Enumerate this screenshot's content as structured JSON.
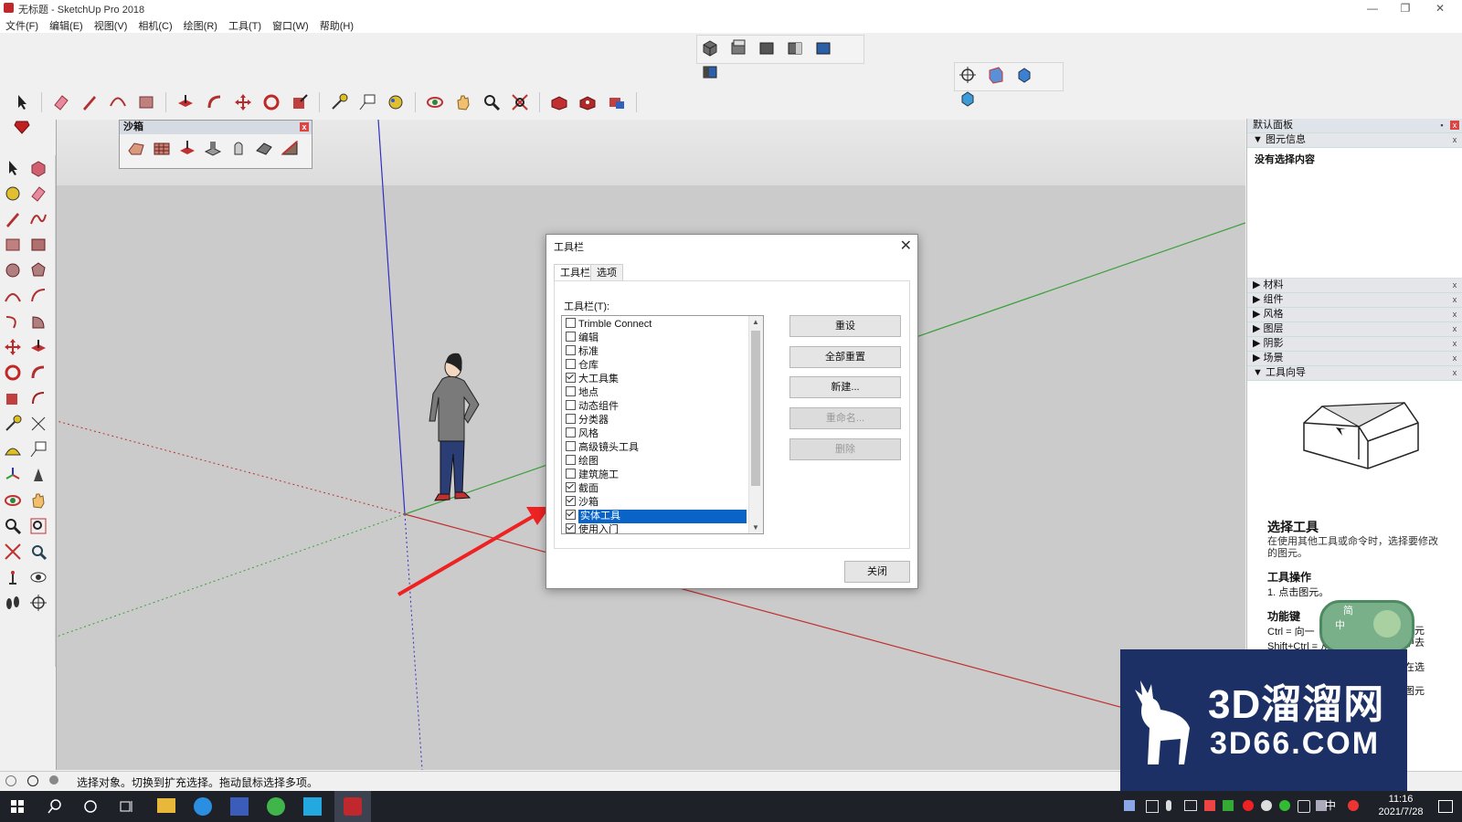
{
  "window": {
    "title": "无标题 - SketchUp Pro 2018",
    "minimize": "—",
    "restore": "❐",
    "close": "✕"
  },
  "menu": [
    "文件(F)",
    "编辑(E)",
    "视图(V)",
    "相机(C)",
    "绘图(R)",
    "工具(T)",
    "窗口(W)",
    "帮助(H)"
  ],
  "sandbox": {
    "title": "沙箱",
    "close": "x"
  },
  "dialog": {
    "title": "工具栏",
    "close": "✕",
    "tabs": [
      "工具栏",
      "选项"
    ],
    "list_label": "工具栏(T):",
    "items": [
      {
        "label": "Trimble Connect",
        "checked": false
      },
      {
        "label": "编辑",
        "checked": false
      },
      {
        "label": "标准",
        "checked": false
      },
      {
        "label": "仓库",
        "checked": false
      },
      {
        "label": "大工具集",
        "checked": true
      },
      {
        "label": "地点",
        "checked": false
      },
      {
        "label": "动态组件",
        "checked": false
      },
      {
        "label": "分类器",
        "checked": false
      },
      {
        "label": "风格",
        "checked": false
      },
      {
        "label": "高级镜头工具",
        "checked": false
      },
      {
        "label": "绘图",
        "checked": false
      },
      {
        "label": "建筑施工",
        "checked": false
      },
      {
        "label": "截面",
        "checked": true
      },
      {
        "label": "沙箱",
        "checked": true
      },
      {
        "label": "实体工具",
        "checked": true,
        "selected": true
      },
      {
        "label": "使用入门",
        "checked": true
      }
    ],
    "buttons": {
      "reset": "重设",
      "reset_all": "全部重置",
      "new": "新建...",
      "rename": "重命名...",
      "delete": "删除",
      "close": "关闭"
    }
  },
  "right_panel": {
    "title": "默认面板",
    "entity_info": {
      "title": "图元信息",
      "content": "没有选择内容"
    },
    "sections": [
      "材料",
      "组件",
      "风格",
      "图层",
      "阴影",
      "场景",
      "工具向导"
    ],
    "guide": {
      "heading": "选择工具",
      "desc": "在使用其他工具或命令时，选择要修改的图元。",
      "ops_title": "工具操作",
      "ops_1": "1. 点击图元。",
      "keys_title": "功能键",
      "key_1": "Ctrl = 向一",
      "key_1b": "图元",
      "key_2": "Shift+Ctrl = 从",
      "key_2b": "中去",
      "key_3": "在选",
      "key_4": "图元"
    }
  },
  "status": {
    "text": "选择对象。切换到扩充选择。拖动鼠标选择多项。"
  },
  "taskbar": {
    "time": "11:16",
    "date": "2021/7/28",
    "ime_lang": "中"
  },
  "ime": {
    "top": "简",
    "left": "中"
  },
  "watermark": {
    "main": "3D溜溜网",
    "sub": "3D66.COM"
  },
  "colors": {
    "accent": "#0a64c8",
    "axis_red": "#c03030",
    "axis_green": "#3aa03a",
    "axis_blue": "#3030c0",
    "arrow": "#ee2222"
  }
}
